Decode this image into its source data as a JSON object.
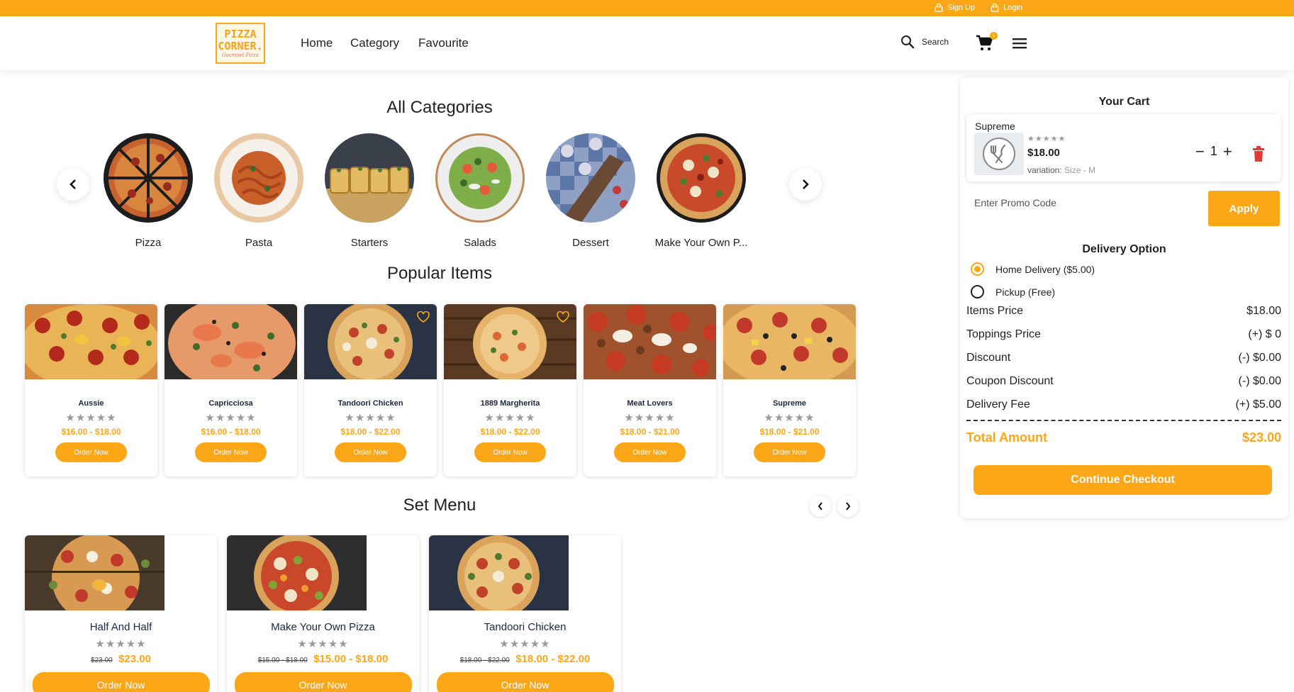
{
  "topbar": {
    "signup": "Sign Up",
    "login": "Login"
  },
  "logo": {
    "line1": "PIZZA",
    "line2": "CORNER.",
    "tagline": "Gourmet Pizza"
  },
  "nav": {
    "home": "Home",
    "category": "Category",
    "favourite": "Favourite"
  },
  "header": {
    "search_label": "Search",
    "cart_count": "1"
  },
  "categories": {
    "title": "All Categories",
    "items": [
      {
        "label": "Pizza"
      },
      {
        "label": "Pasta"
      },
      {
        "label": "Starters"
      },
      {
        "label": "Salads"
      },
      {
        "label": "Dessert"
      },
      {
        "label": "Make Your Own P..."
      }
    ]
  },
  "popular": {
    "title": "Popular Items",
    "order_label": "Order Now",
    "items": [
      {
        "name": "Aussie",
        "price": "$16.00 - $18.00"
      },
      {
        "name": "Capricciosa",
        "price": "$16.00 - $18.00"
      },
      {
        "name": "Tandoori Chicken",
        "price": "$18.00 - $22.00"
      },
      {
        "name": "1889 Margherita",
        "price": "$18.00 - $22.00"
      },
      {
        "name": "Meat Lovers",
        "price": "$18.00 - $21.00"
      },
      {
        "name": "Supreme",
        "price": "$18.00 - $21.00"
      }
    ]
  },
  "set_menu": {
    "title": "Set Menu",
    "order_label": "Order Now",
    "items": [
      {
        "name": "Half And Half",
        "old_price": "$23.00",
        "price": "$23.00"
      },
      {
        "name": "Make Your Own Pizza",
        "old_price": "$15.00 - $18.00",
        "price": "$15.00 - $18.00"
      },
      {
        "name": "Tandoori Chicken",
        "old_price": "$18.00 - $22.00",
        "price": "$18.00 - $22.00"
      }
    ]
  },
  "cart": {
    "title": "Your Cart",
    "item": {
      "name": "Supreme",
      "price": "$18.00",
      "variation_label": "variation:",
      "variation_value": "Size - M",
      "quantity": "1"
    },
    "promo_placeholder": "Enter Promo Code",
    "apply_label": "Apply",
    "delivery_title": "Delivery Option",
    "delivery_options": [
      {
        "label": "Home Delivery",
        "fee": "($5.00)",
        "selected": true
      },
      {
        "label": "Pickup",
        "fee": "(Free)",
        "selected": false
      }
    ],
    "summary": [
      {
        "label": "Items Price",
        "value": "$18.00"
      },
      {
        "label": "Toppings Price",
        "value": "(+) $ 0"
      },
      {
        "label": "Discount",
        "value": "(-) $0.00"
      },
      {
        "label": "Coupon Discount",
        "value": "(-) $0.00"
      },
      {
        "label": "Delivery Fee",
        "value": "(+) $5.00"
      }
    ],
    "total_label": "Total Amount",
    "total_value": "$23.00",
    "checkout_label": "Continue Checkout"
  },
  "colors": {
    "accent": "#fca718",
    "dark_text": "#1c2541"
  }
}
